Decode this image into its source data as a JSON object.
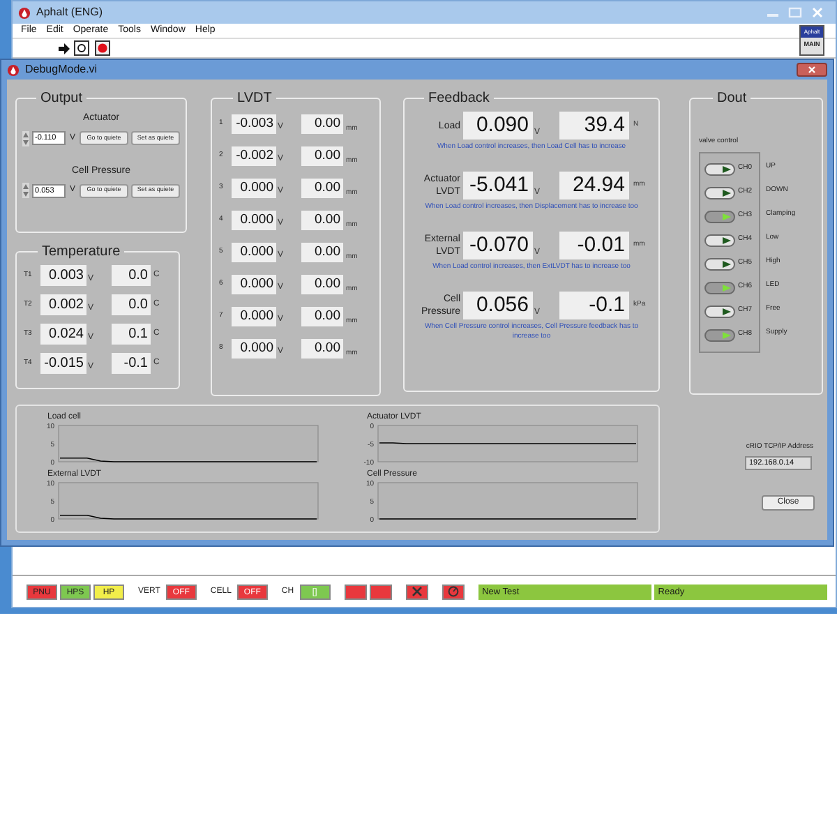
{
  "main_window": {
    "title": "Aphalt (ENG)",
    "menu": [
      "File",
      "Edit",
      "Operate",
      "Tools",
      "Window",
      "Help"
    ],
    "badge": [
      "Aphalt",
      "MAIN"
    ]
  },
  "debug_window": {
    "title": "DebugMode.vi"
  },
  "output": {
    "title": "Output",
    "controls": [
      {
        "label": "Actuator",
        "value": "-0.110",
        "unit": "V",
        "buttons": [
          "Go to quiete",
          "Set as quiete"
        ]
      },
      {
        "label": "Cell Pressure",
        "value": "0.053",
        "unit": "V",
        "buttons": [
          "Go to quiete",
          "Set as quiete"
        ]
      }
    ]
  },
  "temperature": {
    "title": "Temperature",
    "rows": [
      {
        "label": "T1",
        "voltage": "0.003",
        "voltage_unit": "V",
        "value": "0.0",
        "unit": "C"
      },
      {
        "label": "T2",
        "voltage": "0.002",
        "voltage_unit": "V",
        "value": "0.0",
        "unit": "C"
      },
      {
        "label": "T3",
        "voltage": "0.024",
        "voltage_unit": "V",
        "value": "0.1",
        "unit": "C"
      },
      {
        "label": "T4",
        "voltage": "-0.015",
        "voltage_unit": "V",
        "value": "-0.1",
        "unit": "C"
      }
    ]
  },
  "lvdt": {
    "title": "LVDT",
    "rows": [
      {
        "label": "1",
        "voltage": "-0.003",
        "voltage_unit": "V",
        "value": "0.00",
        "unit": "mm"
      },
      {
        "label": "2",
        "voltage": "-0.002",
        "voltage_unit": "V",
        "value": "0.00",
        "unit": "mm"
      },
      {
        "label": "3",
        "voltage": "0.000",
        "voltage_unit": "V",
        "value": "0.00",
        "unit": "mm"
      },
      {
        "label": "4",
        "voltage": "0.000",
        "voltage_unit": "V",
        "value": "0.00",
        "unit": "mm"
      },
      {
        "label": "5",
        "voltage": "0.000",
        "voltage_unit": "V",
        "value": "0.00",
        "unit": "mm"
      },
      {
        "label": "6",
        "voltage": "0.000",
        "voltage_unit": "V",
        "value": "0.00",
        "unit": "mm"
      },
      {
        "label": "7",
        "voltage": "0.000",
        "voltage_unit": "V",
        "value": "0.00",
        "unit": "mm"
      },
      {
        "label": "8",
        "voltage": "0.000",
        "voltage_unit": "V",
        "value": "0.00",
        "unit": "mm"
      }
    ]
  },
  "feedback": {
    "title": "Feedback",
    "rows": [
      {
        "label": "Load",
        "voltage": "0.090",
        "voltage_unit": "V",
        "value": "39.4",
        "unit": "N",
        "note": "When Load control increases, then Load Cell has to increase"
      },
      {
        "label": "Actuator LVDT",
        "voltage": "-5.041",
        "voltage_unit": "V",
        "value": "24.94",
        "unit": "mm",
        "note": "When Load control increases, then Displacement has to increase too"
      },
      {
        "label": "External LVDT",
        "voltage": "-0.070",
        "voltage_unit": "V",
        "value": "-0.01",
        "unit": "mm",
        "note": "When Load control increases, then ExtLVDT has to increase too"
      },
      {
        "label": "Cell Pressure",
        "voltage": "0.056",
        "voltage_unit": "V",
        "value": "-0.1",
        "unit": "kPa",
        "note": "When Cell Pressure control increases, Cell Pressure feedback has to increase too"
      }
    ]
  },
  "dout": {
    "title": "Dout",
    "group_label": "valve control",
    "channels": [
      {
        "channel": "CH0",
        "name": "UP",
        "on": false
      },
      {
        "channel": "CH2",
        "name": "DOWN",
        "on": false
      },
      {
        "channel": "CH3",
        "name": "Clamping",
        "on": true
      },
      {
        "channel": "CH4",
        "name": "Low",
        "on": false
      },
      {
        "channel": "CH5",
        "name": "High",
        "on": false
      },
      {
        "channel": "CH6",
        "name": "LED",
        "on": true
      },
      {
        "channel": "CH7",
        "name": "Free",
        "on": false
      },
      {
        "channel": "CH8",
        "name": "Supply",
        "on": true
      }
    ]
  },
  "charts": [
    {
      "chart_data": {
        "type": "line",
        "title": "Load cell",
        "ylim": [
          0,
          10
        ],
        "yticks": [
          0,
          5,
          10
        ],
        "series": [
          {
            "color": "#000000",
            "values": [
              1,
              1,
              1,
              0.2,
              0,
              0,
              0,
              0,
              0,
              0,
              0,
              0,
              0,
              0,
              0,
              0,
              0,
              0,
              0,
              0
            ]
          }
        ]
      }
    },
    {
      "chart_data": {
        "type": "line",
        "title": "Actuator LVDT",
        "ylim": [
          -10,
          0
        ],
        "yticks": [
          -10,
          -5,
          0
        ],
        "series": [
          {
            "color": "#000000",
            "values": [
              -4.8,
              -4.8,
              -5,
              -5,
              -5,
              -5,
              -5,
              -5,
              -5,
              -5,
              -5,
              -5,
              -5,
              -5,
              -5,
              -5,
              -5,
              -5,
              -5,
              -5
            ]
          }
        ]
      }
    },
    {
      "chart_data": {
        "type": "line",
        "title": "External LVDT",
        "ylim": [
          0,
          10
        ],
        "yticks": [
          0,
          5,
          10
        ],
        "series": [
          {
            "color": "#000000",
            "values": [
              1,
              1,
              1,
              0.2,
              0,
              0,
              0,
              0,
              0,
              0,
              0,
              0,
              0,
              0,
              0,
              0,
              0,
              0,
              0,
              0
            ]
          }
        ]
      }
    },
    {
      "chart_data": {
        "type": "line",
        "title": "Cell Pressure",
        "ylim": [
          0,
          10
        ],
        "yticks": [
          0,
          5,
          10
        ],
        "series": [
          {
            "color": "#000000",
            "values": [
              0,
              0,
              0,
              0,
              0,
              0,
              0,
              0,
              0,
              0,
              0,
              0,
              0,
              0,
              0,
              0,
              0,
              0,
              0,
              0
            ]
          }
        ]
      }
    }
  ],
  "crio": {
    "label": "cRIO TCP/IP Address",
    "value": "192.168.0.14"
  },
  "close_button": "Close",
  "status_bar": [
    {
      "kind": "lamp",
      "text": "PNU",
      "color": "#e8383d"
    },
    {
      "kind": "lamp",
      "text": "HPS",
      "color": "#7ec850"
    },
    {
      "kind": "lamp",
      "text": "HP",
      "color": "#f2ee4a"
    },
    {
      "kind": "switch",
      "label": "VERT",
      "text": "OFF",
      "color": "#e8383d"
    },
    {
      "kind": "switch",
      "label": "CELL",
      "text": "OFF",
      "color": "#e8383d"
    },
    {
      "kind": "switch",
      "label": "CH",
      "text": "[]",
      "color": "#7ec850"
    },
    {
      "kind": "button",
      "color": "#e8383d"
    },
    {
      "kind": "button",
      "color": "#e8383d"
    },
    {
      "kind": "cross-button",
      "color": "#e8383d"
    },
    {
      "kind": "dial-button",
      "color": "#e8383d"
    },
    {
      "kind": "message",
      "text": "New Test",
      "color": "#8cc63f"
    },
    {
      "kind": "message",
      "text": "Ready",
      "color": "#8cc63f"
    }
  ]
}
